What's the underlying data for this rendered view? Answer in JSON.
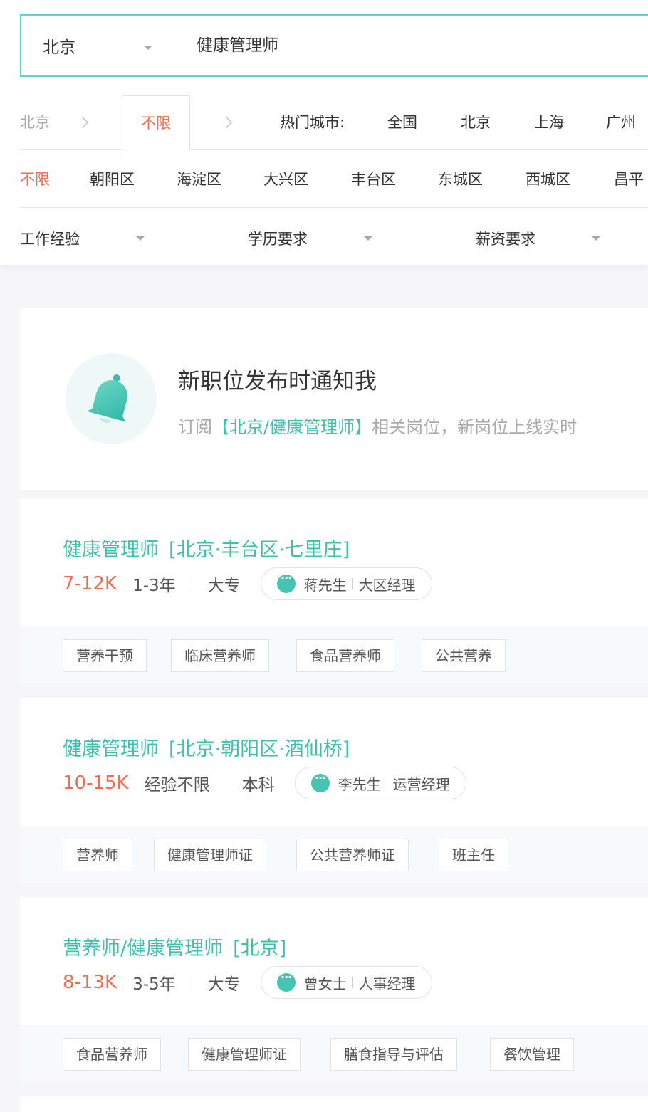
{
  "search": {
    "city": "北京",
    "keyword": "健康管理师"
  },
  "city_filter": {
    "breadcrumb": "北京",
    "selected": "不限",
    "hot_label": "热门城市:",
    "hot_cities": [
      "全国",
      "北京",
      "上海",
      "广州"
    ]
  },
  "districts": [
    "不限",
    "朝阳区",
    "海淀区",
    "大兴区",
    "丰台区",
    "东城区",
    "西城区",
    "昌平"
  ],
  "filters": [
    "工作经验",
    "学历要求",
    "薪资要求"
  ],
  "notify": {
    "title": "新职位发布时通知我",
    "desc_prefix": "订阅",
    "desc_highlight": "【北京/健康管理师】",
    "desc_suffix": "相关岗位，新岗位上线实时"
  },
  "jobs": [
    {
      "title": "健康管理师",
      "location": "[北京·丰台区·七里庄]",
      "salary": "7-12K",
      "experience": "1-3年",
      "education": "大专",
      "recruiter_name": "蒋先生",
      "recruiter_role": "大区经理",
      "tags": [
        "营养干预",
        "临床营养师",
        "食品营养师",
        "公共营养"
      ]
    },
    {
      "title": "健康管理师",
      "location": "[北京·朝阳区·酒仙桥]",
      "salary": "10-15K",
      "experience": "经验不限",
      "education": "本科",
      "recruiter_name": "李先生",
      "recruiter_role": "运营经理",
      "tags": [
        "营养师",
        "健康管理师证",
        "公共营养师证",
        "班主任"
      ]
    },
    {
      "title": "营养师/健康管理师",
      "location": "[北京]",
      "salary": "8-13K",
      "experience": "3-5年",
      "education": "大专",
      "recruiter_name": "曾女士",
      "recruiter_role": "人事经理",
      "tags": [
        "食品营养师",
        "健康管理师证",
        "膳食指导与评估",
        "餐饮管理"
      ]
    }
  ],
  "colors": {
    "accent": "#3dc0ad",
    "salary": "#f26c4f",
    "selected": "#f26c4f"
  }
}
